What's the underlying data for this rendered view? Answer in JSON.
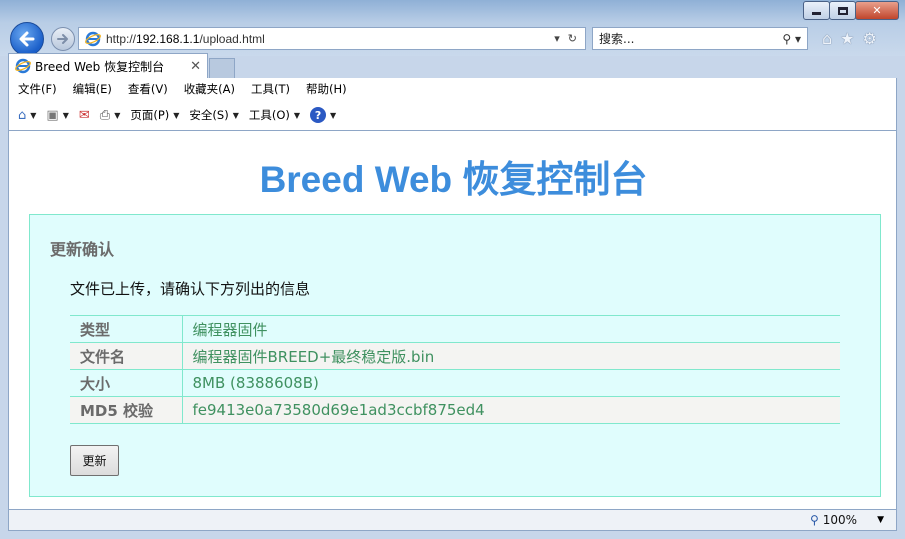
{
  "window": {
    "minimize_label": "",
    "maximize_label": "",
    "close_label": "✕"
  },
  "address": {
    "url_prefix": "http://",
    "url_host": "192.168.1.1",
    "url_path": "/upload.html"
  },
  "search": {
    "placeholder": "搜索..."
  },
  "tab": {
    "title": "Breed Web 恢复控制台",
    "close": "✕"
  },
  "menubar": {
    "items": [
      "文件(F)",
      "编辑(E)",
      "查看(V)",
      "收藏夹(A)",
      "工具(T)",
      "帮助(H)"
    ]
  },
  "commandbar": {
    "page_label": "页面(P)",
    "safety_label": "安全(S)",
    "tools_label": "工具(O)"
  },
  "page": {
    "title": "Breed Web 恢复控制台",
    "panel_title": "更新确认",
    "message": "文件已上传，请确认下方列出的信息",
    "rows": [
      {
        "key": "类型",
        "value": "编程器固件"
      },
      {
        "key": "文件名",
        "value": "编程器固件BREED+最终稳定版.bin"
      },
      {
        "key": "大小",
        "value": "8MB (8388608B)"
      },
      {
        "key": "MD5 校验",
        "value": "fe9413e0a73580d69e1ad3ccbf875ed4"
      }
    ],
    "update_button": "更新"
  },
  "status": {
    "zoom": "100%"
  },
  "colors": {
    "title_blue": "#3d8ddc",
    "panel_bg": "#e0fdfd",
    "panel_border": "#80e8cd",
    "value_green": "#3f9160",
    "key_gray": "#6b6b6b"
  }
}
